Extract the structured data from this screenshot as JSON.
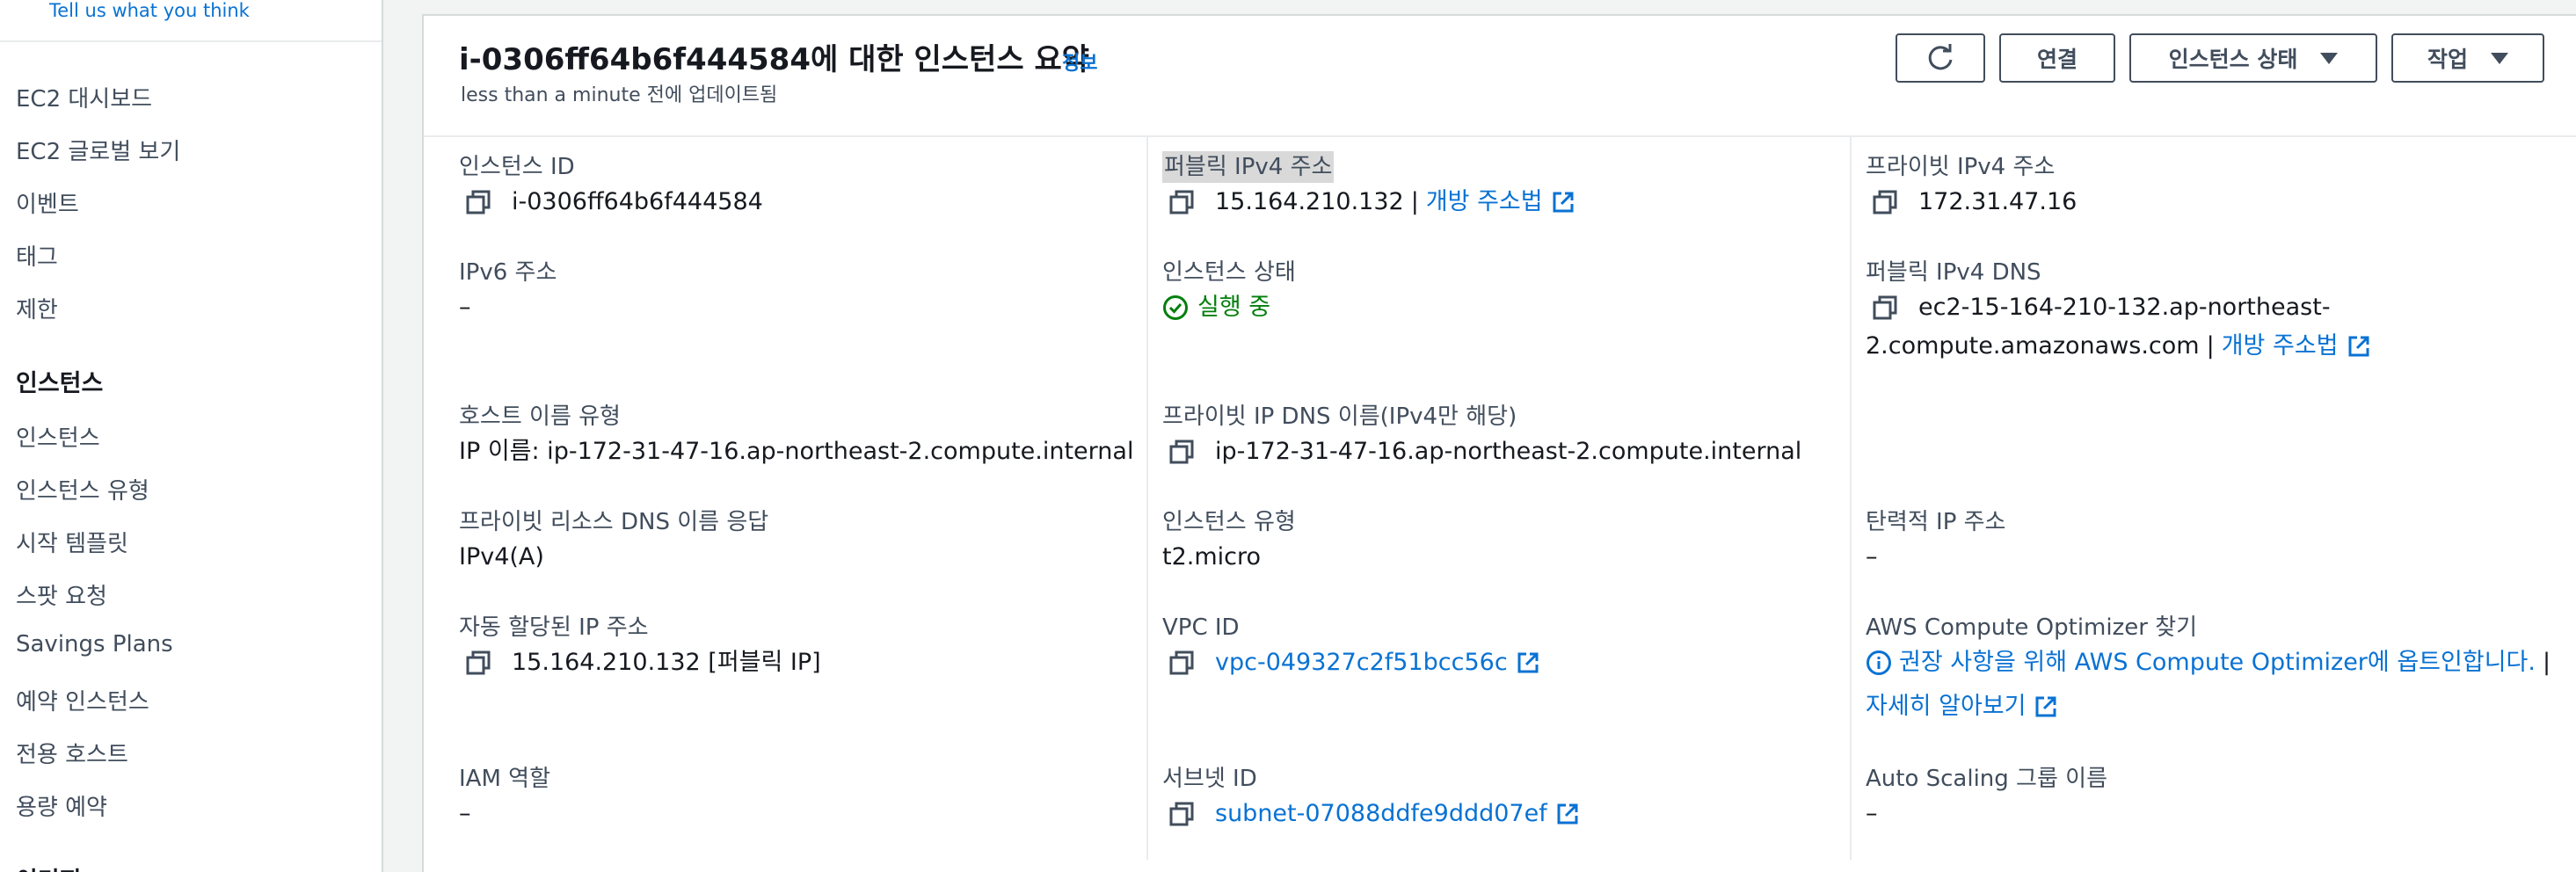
{
  "sidebar": {
    "feedback": "Tell us what you think",
    "items_top": [
      "EC2 대시보드",
      "EC2 글로벌 보기",
      "이벤트",
      "태그",
      "제한"
    ],
    "section": "인스턴스",
    "items_instances": [
      "인스턴스",
      "인스턴스 유형",
      "시작 템플릿",
      "스팟 요청",
      "Savings Plans",
      "예약 인스턴스",
      "전용 호스트",
      "용량 예약"
    ],
    "next_section": "이미지"
  },
  "header": {
    "title": "i-0306ff64b6f444584에 대한 인스턴스 요약",
    "info": "정보",
    "subtitle": "less than a minute 전에 업데이트됨",
    "connect": "연결",
    "state": "인스턴스 상태",
    "actions": "작업"
  },
  "fields": {
    "instance_id_label": "인스턴스 ID",
    "instance_id": "i-0306ff64b6f444584",
    "public_ipv4_label": "퍼블릭 IPv4 주소",
    "public_ipv4": "15.164.210.132",
    "open_address": "개방 주소법",
    "private_ipv4_label": "프라이빗 IPv4 주소",
    "private_ipv4": "172.31.47.16",
    "ipv6_label": "IPv6 주소",
    "ipv6": "–",
    "state_label": "인스턴스 상태",
    "state": "실행 중",
    "public_dns_label": "퍼블릭 IPv4 DNS",
    "public_dns_line1": "ec2-15-164-210-132.ap-northeast-",
    "public_dns_line2": "2.compute.amazonaws.com",
    "hostname_type_label": "호스트 이름 유형",
    "hostname_type": "IP 이름: ip-172-31-47-16.ap-northeast-2.compute.internal",
    "private_dns_label": "프라이빗 IP DNS 이름(IPv4만 해당)",
    "private_dns": "ip-172-31-47-16.ap-northeast-2.compute.internal",
    "resource_dns_label": "프라이빗 리소스 DNS 이름 응답",
    "resource_dns": "IPv4(A)",
    "instance_type_label": "인스턴스 유형",
    "instance_type": "t2.micro",
    "elastic_ip_label": "탄력적 IP 주소",
    "elastic_ip": "–",
    "auto_ip_label": "자동 할당된 IP 주소",
    "auto_ip": "15.164.210.132 [퍼블릭 IP]",
    "vpc_label": "VPC ID",
    "vpc": "vpc-049327c2f51bcc56c",
    "optimizer_label": "AWS Compute Optimizer 찾기",
    "optimizer_text": "권장 사항을 위해 AWS Compute Optimizer에 옵트인합니다.",
    "learn_more": "자세히 알아보기",
    "iam_label": "IAM 역할",
    "iam": "–",
    "subnet_label": "서브넷 ID",
    "subnet": "subnet-07088ddfe9ddd07ef",
    "asg_label": "Auto Scaling 그룹 이름",
    "asg": "–",
    "separator": "|"
  },
  "colors": {
    "link": "#0972d3",
    "running": "#037f0c",
    "text": "#16191f",
    "label": "#414d5c"
  }
}
